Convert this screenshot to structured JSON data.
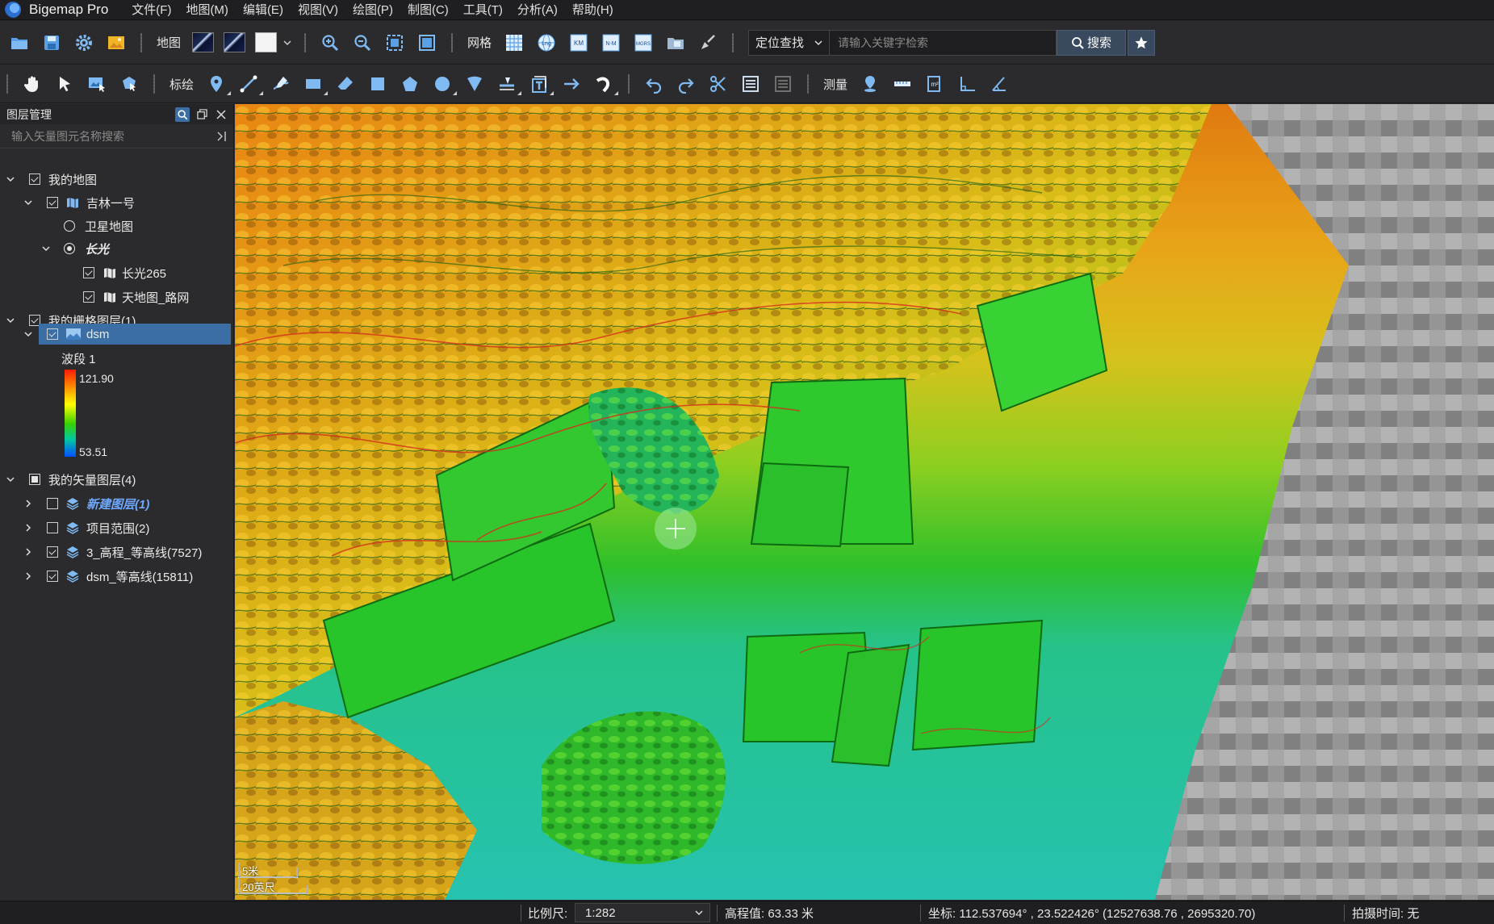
{
  "app": {
    "title": "Bigemap Pro"
  },
  "menu": [
    "文件(F)",
    "地图(M)",
    "编辑(E)",
    "视图(V)",
    "绘图(P)",
    "制图(C)",
    "工具(T)",
    "分析(A)",
    "帮助(H)"
  ],
  "toolbar1": {
    "map_label": "地图",
    "grid_label": "网格",
    "grid_tools": [
      "Lng",
      "KM",
      "N-M",
      "MGRS"
    ],
    "locate_select": "定位查找",
    "search_placeholder": "请输入关键字检索",
    "search_button": "搜索"
  },
  "toolbar2": {
    "draw_label": "标绘",
    "measure_label": "测量",
    "area_unit_glyph": "m²"
  },
  "layer_panel": {
    "title": "图层管理",
    "search_placeholder": "输入矢量图元名称搜索",
    "tree": [
      {
        "label": "我的地图"
      },
      {
        "label": "吉林一号"
      },
      {
        "label": "卫星地图"
      },
      {
        "label": "长光"
      },
      {
        "label": "长光265"
      },
      {
        "label": "天地图_路网"
      },
      {
        "label": "我的栅格图层(1)"
      },
      {
        "label": "dsm"
      },
      {
        "label": "我的矢量图层(4)"
      },
      {
        "label": "新建图层(1)"
      },
      {
        "label": "项目范围(2)"
      },
      {
        "label": "3_高程_等高线(7527)"
      },
      {
        "label": "dsm_等高线(15811)"
      }
    ],
    "legend": {
      "band": "波段 1",
      "max": "121.90",
      "min": "53.51"
    }
  },
  "map": {
    "scale_metric": "5米",
    "scale_imperial": "20英尺",
    "colors": {
      "low": "#2ec4a8",
      "mid": "#2fbf2a",
      "high": "#e58a12",
      "contour": "#d2301c"
    }
  },
  "status": {
    "scale_label": "比例尺:",
    "scale_value": "1:282",
    "elevation": "高程值: 63.33 米",
    "coords": "坐标: 112.537694° , 23.522426°  (12527638.76 , 2695320.70)",
    "capture_time": "拍摄时间: 无"
  }
}
